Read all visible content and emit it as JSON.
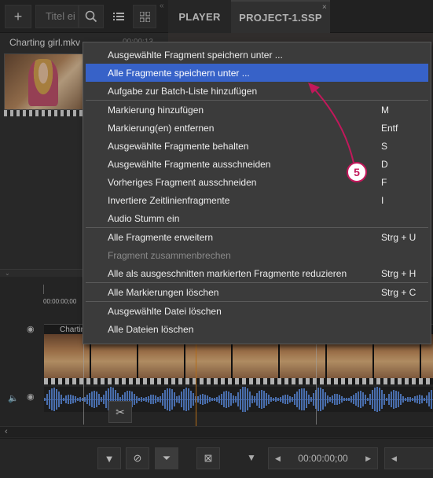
{
  "toolbar": {
    "add_icon": "+",
    "search_placeholder": "Titel ei",
    "search_icon": "magnifier",
    "list_icon": "list-view",
    "grid_icon": "grid-view",
    "collapse": "«",
    "tabs": [
      {
        "label": "PLAYER"
      },
      {
        "label": "PROJECT-1.SSP",
        "close": "×"
      }
    ]
  },
  "media": {
    "file_name": "Charting girl.mkv",
    "duration": "00:00:13"
  },
  "timeline": {
    "ruler_time": "00:00:00;00",
    "track_label": "Chartin"
  },
  "context_menu": {
    "items": [
      {
        "label": "Ausgewählte Fragment speichern unter ...",
        "shortcut": "",
        "state": "normal"
      },
      {
        "label": "Alle Fragmente speichern unter ...",
        "shortcut": "",
        "state": "highlight"
      },
      {
        "label": "Aufgabe zur Batch-Liste hinzufügen",
        "shortcut": "",
        "state": "normal"
      },
      {
        "separator": true
      },
      {
        "label": "Markierung hinzufügen",
        "shortcut": "M",
        "state": "normal"
      },
      {
        "label": "Markierung(en) entfernen",
        "shortcut": "Entf",
        "state": "normal"
      },
      {
        "label": "Ausgewählte Fragmente behalten",
        "shortcut": "S",
        "state": "normal"
      },
      {
        "label": "Ausgewählte Fragmente ausschneiden",
        "shortcut": "D",
        "state": "normal"
      },
      {
        "label": "Vorheriges Fragment ausschneiden",
        "shortcut": "F",
        "state": "normal"
      },
      {
        "label": "Invertiere Zeitlinienfragmente",
        "shortcut": "I",
        "state": "normal"
      },
      {
        "label": "Audio Stumm ein",
        "shortcut": "",
        "state": "normal"
      },
      {
        "separator": true
      },
      {
        "label": "Alle Fragmente erweitern",
        "shortcut": "Strg + U",
        "state": "normal"
      },
      {
        "label": "Fragment zusammenbrechen",
        "shortcut": "",
        "state": "disabled"
      },
      {
        "label": "Alle als ausgeschnitten markierten Fragmente reduzieren",
        "shortcut": "Strg + H",
        "state": "normal"
      },
      {
        "separator": true
      },
      {
        "label": "Alle Markierungen löschen",
        "shortcut": "Strg + C",
        "state": "normal"
      },
      {
        "separator": true
      },
      {
        "label": "Ausgewählte Datei löschen",
        "shortcut": "",
        "state": "normal"
      },
      {
        "label": "Alle Dateien löschen",
        "shortcut": "",
        "state": "normal"
      }
    ]
  },
  "annotation": {
    "number": "5",
    "color": "#c2185b"
  },
  "bottom_bar": {
    "time_start": "00:00:00;00",
    "time_end_partial": "◂"
  },
  "colors": {
    "highlight": "#3762c8",
    "playhead": "#e88a1a",
    "waveform": "#5b8de0"
  }
}
